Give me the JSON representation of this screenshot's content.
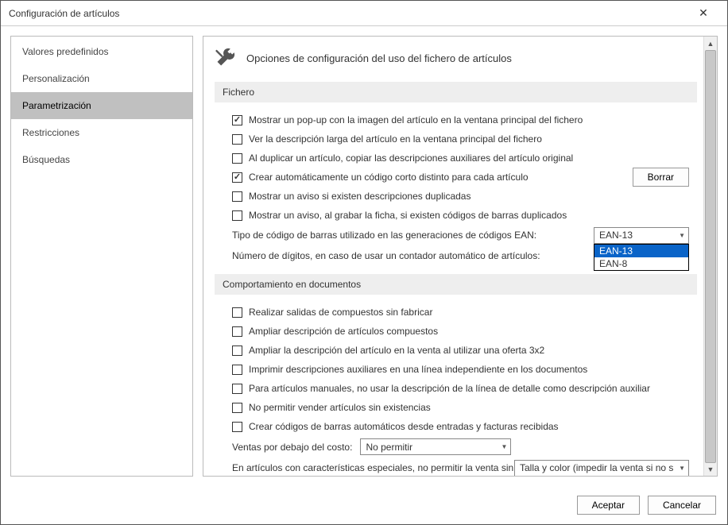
{
  "window": {
    "title": "Configuración de artículos"
  },
  "sidebar": {
    "items": [
      {
        "label": "Valores predefinidos"
      },
      {
        "label": "Personalización"
      },
      {
        "label": "Parametrización"
      },
      {
        "label": "Restricciones"
      },
      {
        "label": "Búsquedas"
      }
    ]
  },
  "header": {
    "title": "Opciones de configuración del uso del fichero de artículos"
  },
  "sections": {
    "fichero": {
      "title": "Fichero",
      "items": {
        "popup_image": {
          "checked": true,
          "label": "Mostrar un pop-up con la imagen del artículo en la ventana principal del fichero"
        },
        "long_desc": {
          "checked": false,
          "label": "Ver la descripción larga del artículo en la ventana principal del fichero"
        },
        "copy_aux": {
          "checked": false,
          "label": "Al duplicar un artículo, copiar las descripciones auxiliares del artículo original"
        },
        "auto_code": {
          "checked": true,
          "label": "Crear automáticamente un código corto distinto para cada artículo",
          "button": "Borrar"
        },
        "dup_desc_warn": {
          "checked": false,
          "label": "Mostrar un aviso si existen descripciones duplicadas"
        },
        "dup_barcode_warn": {
          "checked": false,
          "label": "Mostrar un aviso, al grabar la ficha, si existen códigos de barras duplicados"
        },
        "barcode_type": {
          "label": "Tipo de código de barras utilizado en las generaciones de códigos EAN:",
          "value": "EAN-13",
          "options": [
            "EAN-13",
            "EAN-8"
          ]
        },
        "num_digits": {
          "label": "Número de dígitos, en caso de usar un contador automático de artículos:"
        }
      }
    },
    "comportamiento": {
      "title": "Comportamiento en documentos",
      "items": {
        "salidas_comp": {
          "checked": false,
          "label": "Realizar salidas de compuestos sin fabricar"
        },
        "ampliar_comp": {
          "checked": false,
          "label": "Ampliar descripción de artículos compuestos"
        },
        "ampliar_3x2": {
          "checked": false,
          "label": "Ampliar la descripción del artículo en la venta al utilizar una oferta 3x2"
        },
        "imprimir_aux": {
          "checked": false,
          "label": "Imprimir descripciones auxiliares en una línea independiente en los documentos"
        },
        "manual_no_aux": {
          "checked": false,
          "label": "Para artículos manuales, no usar la descripción de la línea de detalle como descripción auxiliar"
        },
        "no_sin_exist": {
          "checked": false,
          "label": "No permitir vender artículos sin existencias"
        },
        "crear_barcode": {
          "checked": false,
          "label": "Crear códigos de barras automáticos desde entradas y facturas recibidas"
        },
        "ventas_costo": {
          "label": "Ventas por debajo del costo:",
          "value": "No permitir"
        },
        "carac_esp": {
          "label": "En artículos con características especiales, no permitir la venta sin:",
          "value": "Talla y color (impedir la venta si no s"
        }
      }
    }
  },
  "footer": {
    "ok": "Aceptar",
    "cancel": "Cancelar"
  }
}
